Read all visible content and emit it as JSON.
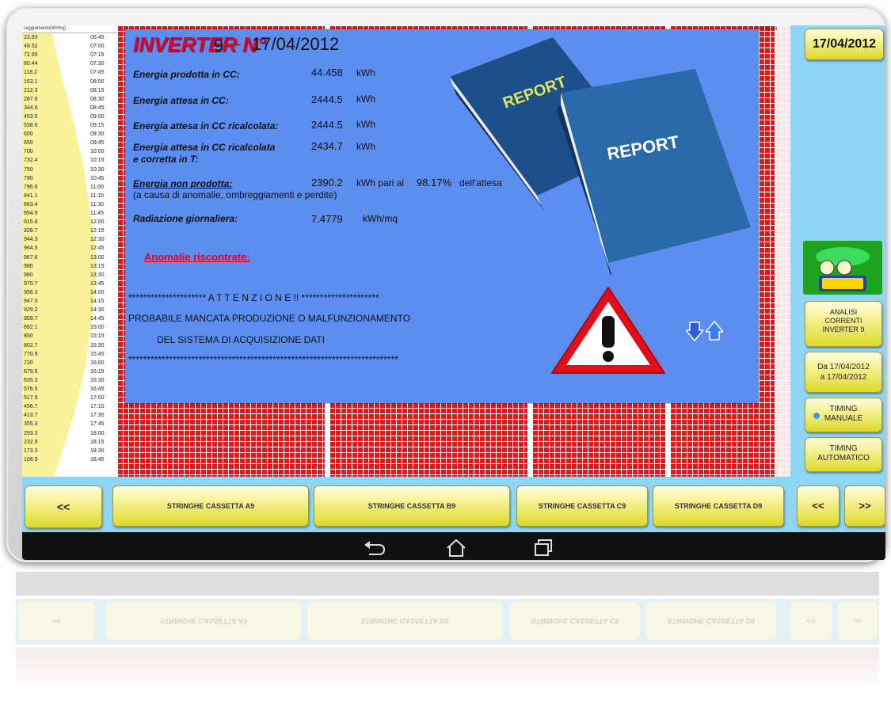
{
  "left_column": {
    "header": "raggiamento(W/mq)",
    "rows": [
      {
        "v": "23.93",
        "t": "06:45"
      },
      {
        "v": "48.52",
        "t": "07:00"
      },
      {
        "v": "72.95",
        "t": "07:15"
      },
      {
        "v": "80.44",
        "t": "07:30"
      },
      {
        "v": "118.2",
        "t": "07:45"
      },
      {
        "v": "163.1",
        "t": "08:00"
      },
      {
        "v": "212.3",
        "t": "08:15"
      },
      {
        "v": "287.6",
        "t": "08:30"
      },
      {
        "v": "344.6",
        "t": "08:45"
      },
      {
        "v": "453.5",
        "t": "09:00"
      },
      {
        "v": "538.6",
        "t": "09:15"
      },
      {
        "v": "600",
        "t": "09:30"
      },
      {
        "v": "650",
        "t": "09:45"
      },
      {
        "v": "700",
        "t": "10:00"
      },
      {
        "v": "732.4",
        "t": "10:15"
      },
      {
        "v": "750",
        "t": "10:30"
      },
      {
        "v": "780",
        "t": "10:45"
      },
      {
        "v": "796.6",
        "t": "11:00"
      },
      {
        "v": "841.1",
        "t": "11:15"
      },
      {
        "v": "863.4",
        "t": "11:30"
      },
      {
        "v": "894.9",
        "t": "11:45"
      },
      {
        "v": "915.8",
        "t": "12:00"
      },
      {
        "v": "928.7",
        "t": "12:15"
      },
      {
        "v": "944.3",
        "t": "12:30"
      },
      {
        "v": "964.5",
        "t": "12:45"
      },
      {
        "v": "967.6",
        "t": "13:00"
      },
      {
        "v": "980",
        "t": "13:15"
      },
      {
        "v": "980",
        "t": "13:30"
      },
      {
        "v": "970.7",
        "t": "13:45"
      },
      {
        "v": "956.3",
        "t": "14:00"
      },
      {
        "v": "947.0",
        "t": "14:15"
      },
      {
        "v": "929.2",
        "t": "14:30"
      },
      {
        "v": "909.7",
        "t": "14:45"
      },
      {
        "v": "892.1",
        "t": "15:00"
      },
      {
        "v": "850",
        "t": "15:15"
      },
      {
        "v": "802.7",
        "t": "15:30"
      },
      {
        "v": "770.9",
        "t": "15:45"
      },
      {
        "v": "720",
        "t": "16:00"
      },
      {
        "v": "679.5",
        "t": "16:15"
      },
      {
        "v": "635.3",
        "t": "16:30"
      },
      {
        "v": "576.5",
        "t": "16:45"
      },
      {
        "v": "517.9",
        "t": "17:00"
      },
      {
        "v": "456.7",
        "t": "17:15"
      },
      {
        "v": "413.7",
        "t": "17:30"
      },
      {
        "v": "355.3",
        "t": "17:45"
      },
      {
        "v": "293.3",
        "t": "18:00"
      },
      {
        "v": "232.9",
        "t": "18:15"
      },
      {
        "v": "173.3",
        "t": "18:30"
      },
      {
        "v": "106.9",
        "t": "18:45"
      }
    ]
  },
  "grid_header_right": "14 15 16",
  "header": {
    "title": "INVERTER N°",
    "number": "9",
    "dash": "-",
    "date": "17/04/2012"
  },
  "stats": {
    "energia_prodotta": {
      "label": "Energia prodotta in CC:",
      "value": "44.458",
      "unit": "kWh"
    },
    "energia_attesa": {
      "label": "Energia attesa in CC:",
      "value": "2444.5",
      "unit": "kWh"
    },
    "energia_ricalcolata": {
      "label": "Energia attesa in CC ricalcolata:",
      "value": "2444.5",
      "unit": "kWh"
    },
    "energia_corretta": {
      "label_line1": "Energia attesa in CC ricalcolata",
      "label_line2": "e corretta in T:",
      "value": "2434.7",
      "unit": "kWh"
    },
    "energia_non_prodotta": {
      "label": "Energia non prodotta:",
      "value": "2390.2",
      "unit": "kWh pari al",
      "pct": "98.17%",
      "suffix": "dell'attesa",
      "note": "(a causa di anomalie, ombreggiamenti e perdite)"
    },
    "radiazione": {
      "label": "Radiazione giornaliera:",
      "value": "7.4779",
      "unit": "kWh/mq"
    }
  },
  "anomalie_label": "Anomalie riscontrate:",
  "messages": {
    "attenzione": "********************* A T T E N Z I O N E !! *********************",
    "line1": "PROBABILE MANCATA PRODUZIONE O MALFUNZIONAMENTO",
    "line2": "DEL SISTEMA DI ACQUISIZIONE DATI",
    "stars": "*************************************************************************"
  },
  "books": {
    "label": "REPORT"
  },
  "right_col": {
    "date": "17/04/2012",
    "report_icon": "report-icon",
    "analisi": [
      "ANALISI",
      "CORRENTI",
      "INVERTER 9"
    ],
    "period": [
      "Da 17/04/2012",
      "a 17/04/2012"
    ],
    "timing_manuale": [
      "TIMING",
      "MANUALE"
    ],
    "timing_automatico": [
      "TIMING",
      "AUTOMATICO"
    ]
  },
  "bottom": {
    "prev_big": "<<",
    "string_buttons": [
      "STRINGHE CASSETTA A9",
      "STRINGHE CASSETTA B9",
      "STRINGHE CASSETTA C9",
      "STRINGHE CASSETTA D9"
    ],
    "prev": "<<",
    "next": ">>"
  },
  "colors": {
    "accent_red": "#e8001c",
    "panel_blue": "#5b8ef0",
    "grid_red": "#e0171a",
    "button_yellow": "#ded92a",
    "background": "#8fd6f4"
  }
}
